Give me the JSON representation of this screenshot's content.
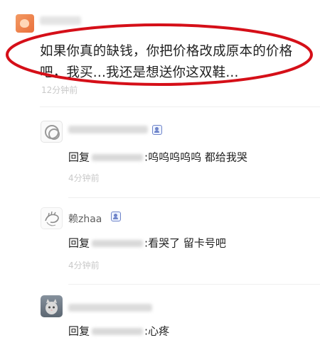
{
  "top_comment": {
    "line1": "如果你真的缺钱，你把价格改成原本的价格",
    "line2": "吧，我买...我还是想送你这双鞋...",
    "time": "12分钟前"
  },
  "replies": [
    {
      "username": "",
      "reply_prefix": "回复",
      "text": ":呜呜呜呜呜 都给我哭",
      "time": "4分钟前"
    },
    {
      "username": "赖zhaa",
      "reply_prefix": "回复",
      "text": ":看哭了 留卡号吧",
      "time": "4分钟前"
    },
    {
      "username": "",
      "reply_prefix": "回复",
      "text": ":心疼",
      "time": ""
    }
  ],
  "colors": {
    "highlight": "#d50f18",
    "text": "#1f1f1f",
    "muted": "#c9c9c9",
    "badge": "#6e84c9"
  },
  "icons": {
    "top_avatar": "cat-avatar-icon",
    "badge": "member-badge-icon"
  }
}
